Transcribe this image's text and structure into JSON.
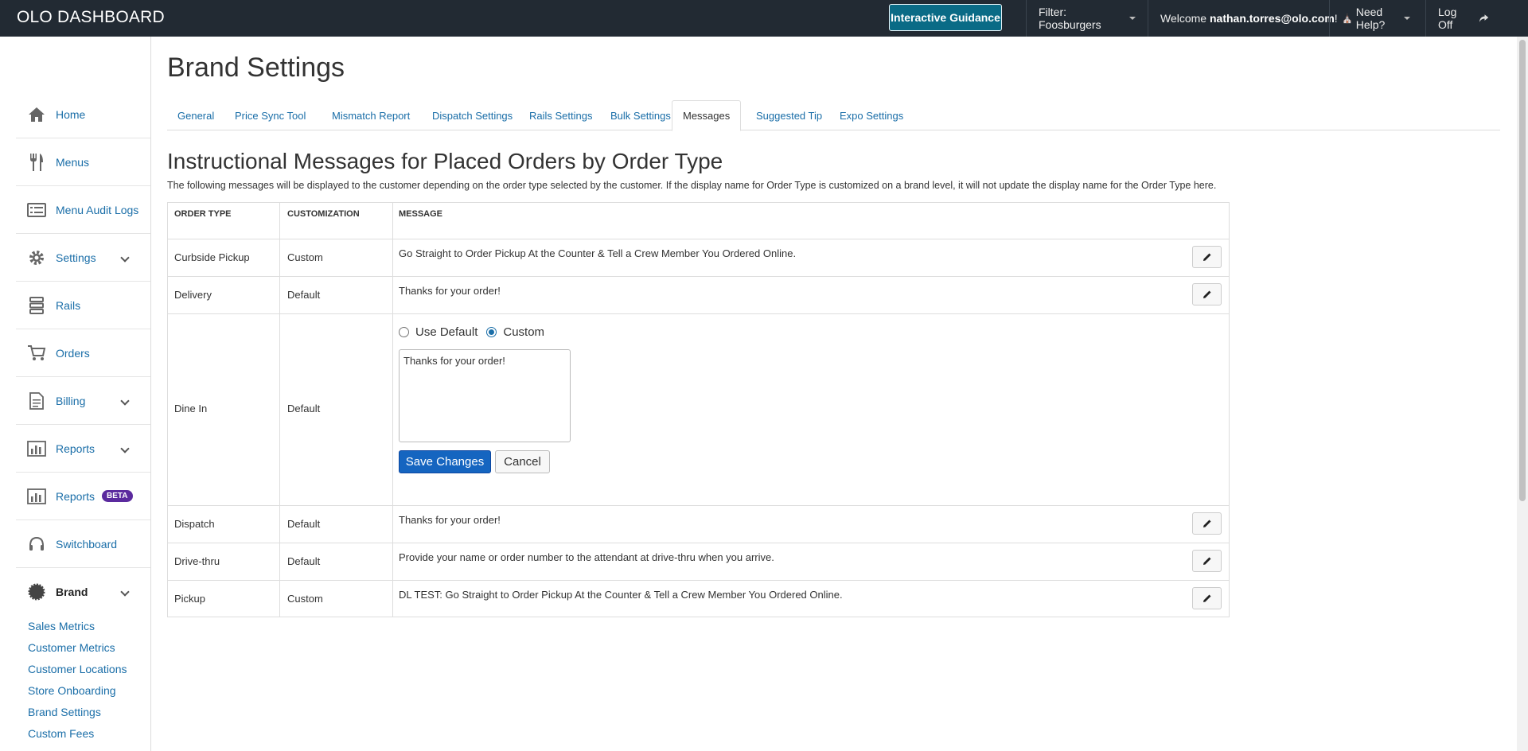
{
  "header": {
    "app_title": "OLO DASHBOARD",
    "guidance_label": "Interactive Guidance",
    "filter_label": "Filter: Foosburgers",
    "welcome_prefix": "Welcome ",
    "username": "nathan.torres@olo.com",
    "welcome_suffix": "!",
    "help_label": "Need Help?",
    "logoff_label": "Log Off"
  },
  "sidebar": {
    "items": [
      {
        "label": "Home",
        "icon": "home-icon"
      },
      {
        "label": "Menus",
        "icon": "utensils-icon"
      },
      {
        "label": "Menu Audit Logs",
        "icon": "list-icon"
      },
      {
        "label": "Settings",
        "icon": "gear-icon"
      },
      {
        "label": "Rails",
        "icon": "rails-icon"
      },
      {
        "label": "Orders",
        "icon": "cart-icon"
      },
      {
        "label": "Billing",
        "icon": "document-icon"
      },
      {
        "label": "Reports",
        "icon": "bar-chart-icon"
      },
      {
        "label": "Reports",
        "icon": "bar-chart-icon",
        "badge": "BETA"
      },
      {
        "label": "Switchboard",
        "icon": "headset-icon"
      },
      {
        "label": "Brand",
        "icon": "badge-icon"
      }
    ],
    "brand_sublinks": [
      "Sales Metrics",
      "Customer Metrics",
      "Customer Locations",
      "Store Onboarding",
      "Brand Settings",
      "Custom Fees"
    ]
  },
  "page": {
    "title": "Brand Settings",
    "tabs": [
      "General",
      "Price Sync Tool",
      "Mismatch Report",
      "Dispatch Settings",
      "Rails Settings",
      "Bulk Settings",
      "Messages",
      "Suggested Tip",
      "Expo Settings"
    ],
    "active_tab": "Messages"
  },
  "section": {
    "heading": "Instructional Messages for Placed Orders by Order Type",
    "description": "The following messages will be displayed to the customer depending on the order type selected by the customer. If the display name for Order Type is customized on a brand level, it will not update the display name for the Order Type here."
  },
  "table": {
    "headers": [
      "ORDER TYPE",
      "CUSTOMIZATION",
      "MESSAGE"
    ],
    "rows": [
      {
        "order_type": "Curbside Pickup",
        "customization": "Custom",
        "message": "Go Straight to Order Pickup At the Counter & Tell a Crew Member You Ordered Online."
      },
      {
        "order_type": "Delivery",
        "customization": "Default",
        "message": "Thanks for your order!"
      },
      {
        "order_type": "Dine In",
        "customization": "Default",
        "message": ""
      },
      {
        "order_type": "Dispatch",
        "customization": "Default",
        "message": "Thanks for your order!"
      },
      {
        "order_type": "Drive-thru",
        "customization": "Default",
        "message": "Provide your name or order number to the attendant at drive-thru when you arrive."
      },
      {
        "order_type": "Pickup",
        "customization": "Custom",
        "message": "DL TEST: Go Straight to Order Pickup At the Counter & Tell a Crew Member You Ordered Online."
      }
    ]
  },
  "editor": {
    "use_default_label": "Use Default",
    "custom_label": "Custom",
    "selected": "Custom",
    "textarea_value": "Thanks for your order!",
    "save_label": "Save Changes",
    "cancel_label": "Cancel"
  },
  "colors": {
    "topbar": "#222a33",
    "link": "#1a6ea8",
    "primary_button": "#1565c0",
    "beta_badge": "#5b2a9e",
    "guidance_button": "#0a6b86"
  }
}
